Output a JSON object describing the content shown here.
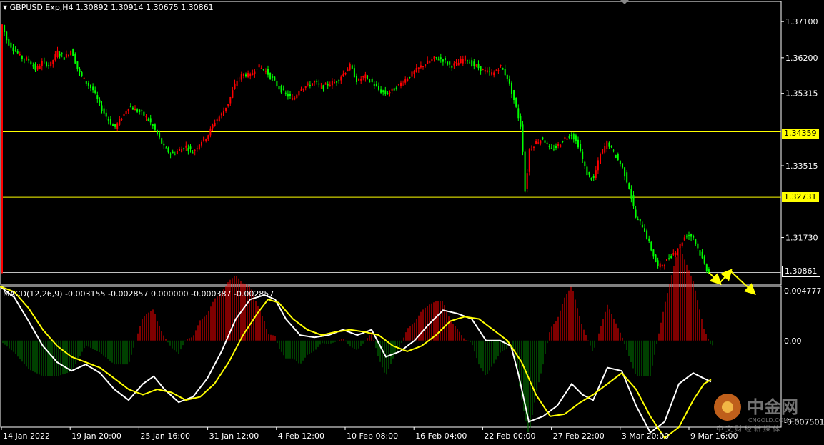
{
  "window": {
    "symbol_header": "GBPUSD.Exp,H4",
    "ohlc": [
      "1.30892",
      "1.30914",
      "1.30675",
      "1.30861"
    ]
  },
  "colors": {
    "background": "#000000",
    "bull": "#ff0000",
    "bear": "#00ff00",
    "level_line": "#ffff00",
    "macd_line": "#ffffff",
    "signal_line": "#ffff00",
    "hist_pos": "#ff0000",
    "hist_neg": "#008000",
    "arrow": "#ffff00"
  },
  "chart_data": [
    {
      "type": "candlestick",
      "title": "GBPUSD.Exp,H4",
      "y_ticks": [
        "1.37100",
        "1.36200",
        "1.35315",
        "1.34359",
        "1.33515",
        "1.32731",
        "1.31730",
        "1.30861"
      ],
      "ylim": [
        1.3055,
        1.376
      ],
      "x_ticks": [
        "14 Jan 2022",
        "19 Jan 20:00",
        "25 Jan 16:00",
        "31 Jan 12:00",
        "4 Feb 12:00",
        "10 Feb 08:00",
        "16 Feb 04:00",
        "22 Feb 00:00",
        "27 Feb 22:00",
        "3 Mar 20:00",
        "9 Mar 16:00"
      ],
      "horizontal_levels": [
        "1.34359",
        "1.32731"
      ],
      "current_price": "1.30861",
      "close_path": [
        [
          0,
          1.372
        ],
        [
          10,
          1.366
        ],
        [
          20,
          1.364
        ],
        [
          30,
          1.362
        ],
        [
          40,
          1.3615
        ],
        [
          50,
          1.359
        ],
        [
          60,
          1.361
        ],
        [
          70,
          1.36
        ],
        [
          80,
          1.3635
        ],
        [
          90,
          1.362
        ],
        [
          100,
          1.364
        ],
        [
          110,
          1.3585
        ],
        [
          120,
          1.356
        ],
        [
          130,
          1.354
        ],
        [
          140,
          1.35
        ],
        [
          150,
          1.347
        ],
        [
          160,
          1.3445
        ],
        [
          170,
          1.347
        ],
        [
          180,
          1.35
        ],
        [
          190,
          1.349
        ],
        [
          200,
          1.348
        ],
        [
          210,
          1.346
        ],
        [
          220,
          1.343
        ],
        [
          230,
          1.3395
        ],
        [
          240,
          1.338
        ],
        [
          250,
          1.339
        ],
        [
          260,
          1.34
        ],
        [
          270,
          1.3385
        ],
        [
          280,
          1.341
        ],
        [
          290,
          1.3425
        ],
        [
          300,
          1.346
        ],
        [
          310,
          1.348
        ],
        [
          320,
          1.351
        ],
        [
          330,
          1.356
        ],
        [
          340,
          1.358
        ],
        [
          350,
          1.3575
        ],
        [
          360,
          1.36
        ],
        [
          370,
          1.359
        ],
        [
          380,
          1.357
        ],
        [
          390,
          1.3545
        ],
        [
          400,
          1.353
        ],
        [
          410,
          1.3515
        ],
        [
          420,
          1.3545
        ],
        [
          430,
          1.355
        ],
        [
          440,
          1.356
        ],
        [
          450,
          1.3545
        ],
        [
          460,
          1.3555
        ],
        [
          470,
          1.356
        ],
        [
          480,
          1.358
        ],
        [
          490,
          1.36
        ],
        [
          500,
          1.356
        ],
        [
          510,
          1.3575
        ],
        [
          520,
          1.356
        ],
        [
          530,
          1.354
        ],
        [
          540,
          1.353
        ],
        [
          550,
          1.354
        ],
        [
          560,
          1.3555
        ],
        [
          570,
          1.357
        ],
        [
          580,
          1.3585
        ],
        [
          590,
          1.36
        ],
        [
          600,
          1.361
        ],
        [
          610,
          1.362
        ],
        [
          620,
          1.3615
        ],
        [
          630,
          1.36
        ],
        [
          640,
          1.3605
        ],
        [
          650,
          1.362
        ],
        [
          660,
          1.3605
        ],
        [
          670,
          1.3595
        ],
        [
          680,
          1.3585
        ],
        [
          690,
          1.358
        ],
        [
          700,
          1.36
        ],
        [
          710,
          1.357
        ],
        [
          720,
          1.351
        ],
        [
          730,
          1.344
        ],
        [
          735,
          1.3275
        ],
        [
          740,
          1.339
        ],
        [
          750,
          1.341
        ],
        [
          760,
          1.342
        ],
        [
          770,
          1.339
        ],
        [
          780,
          1.34
        ],
        [
          790,
          1.342
        ],
        [
          800,
          1.343
        ],
        [
          810,
          1.34
        ],
        [
          820,
          1.3335
        ],
        [
          830,
          1.3315
        ],
        [
          840,
          1.338
        ],
        [
          850,
          1.341
        ],
        [
          860,
          1.338
        ],
        [
          870,
          1.335
        ],
        [
          880,
          1.33
        ],
        [
          890,
          1.322
        ],
        [
          900,
          1.32
        ],
        [
          910,
          1.315
        ],
        [
          920,
          1.31
        ],
        [
          930,
          1.311
        ],
        [
          940,
          1.313
        ],
        [
          950,
          1.315
        ],
        [
          960,
          1.318
        ],
        [
          970,
          1.3175
        ],
        [
          980,
          1.313
        ],
        [
          990,
          1.309
        ],
        [
          995,
          1.3086
        ]
      ],
      "projection_arrows": [
        [
          992,
          1.3086
        ],
        [
          1007,
          1.306
        ],
        [
          1022,
          1.309
        ],
        [
          1055,
          1.3035
        ]
      ]
    },
    {
      "type": "line",
      "title": "MACD(12,26,9)",
      "header_values": [
        "-0.003155",
        "-0.002857",
        "0.000000",
        "-0.000387",
        "-0.002857"
      ],
      "y_ticks": [
        "0.004777",
        "0.00",
        "-0.007501"
      ],
      "ylim": [
        -0.008,
        0.005
      ],
      "series": [
        {
          "name": "MACD",
          "points": [
            [
              0,
              0.005
            ],
            [
              20,
              0.004
            ],
            [
              40,
              0.0018
            ],
            [
              60,
              -0.0005
            ],
            [
              80,
              -0.002
            ],
            [
              100,
              -0.0028
            ],
            [
              120,
              -0.0022
            ],
            [
              140,
              -0.003
            ],
            [
              160,
              -0.0045
            ],
            [
              180,
              -0.0055
            ],
            [
              200,
              -0.004
            ],
            [
              215,
              -0.0033
            ],
            [
              230,
              -0.0045
            ],
            [
              250,
              -0.0057
            ],
            [
              270,
              -0.0052
            ],
            [
              290,
              -0.0035
            ],
            [
              310,
              -0.001
            ],
            [
              330,
              0.002
            ],
            [
              350,
              0.0038
            ],
            [
              370,
              0.0042
            ],
            [
              385,
              0.0038
            ],
            [
              400,
              0.002
            ],
            [
              420,
              0.0005
            ],
            [
              440,
              0.0003
            ],
            [
              460,
              0.0005
            ],
            [
              480,
              0.001
            ],
            [
              500,
              0.0005
            ],
            [
              520,
              0.001
            ],
            [
              540,
              -0.0015
            ],
            [
              560,
              -0.001
            ],
            [
              580,
              0.0
            ],
            [
              600,
              0.0015
            ],
            [
              620,
              0.0028
            ],
            [
              640,
              0.0025
            ],
            [
              660,
              0.002
            ],
            [
              680,
              0.0
            ],
            [
              700,
              0.0
            ],
            [
              715,
              -0.0005
            ],
            [
              725,
              -0.003
            ],
            [
              740,
              -0.0075
            ],
            [
              760,
              -0.007
            ],
            [
              780,
              -0.006
            ],
            [
              800,
              -0.004
            ],
            [
              815,
              -0.005
            ],
            [
              830,
              -0.0055
            ],
            [
              850,
              -0.0025
            ],
            [
              870,
              -0.0028
            ],
            [
              890,
              -0.006
            ],
            [
              910,
              -0.0085
            ],
            [
              930,
              -0.0075
            ],
            [
              950,
              -0.004
            ],
            [
              970,
              -0.003
            ],
            [
              985,
              -0.0035
            ],
            [
              995,
              -0.0038
            ]
          ]
        },
        {
          "name": "Signal",
          "points": [
            [
              0,
              0.005
            ],
            [
              20,
              0.0045
            ],
            [
              40,
              0.003
            ],
            [
              60,
              0.001
            ],
            [
              80,
              -0.0005
            ],
            [
              100,
              -0.0015
            ],
            [
              120,
              -0.002
            ],
            [
              140,
              -0.0025
            ],
            [
              160,
              -0.0035
            ],
            [
              180,
              -0.0045
            ],
            [
              200,
              -0.005
            ],
            [
              220,
              -0.0045
            ],
            [
              240,
              -0.0048
            ],
            [
              260,
              -0.0055
            ],
            [
              280,
              -0.0052
            ],
            [
              300,
              -0.004
            ],
            [
              320,
              -0.002
            ],
            [
              340,
              0.0005
            ],
            [
              360,
              0.0025
            ],
            [
              375,
              0.0038
            ],
            [
              390,
              0.0035
            ],
            [
              410,
              0.002
            ],
            [
              430,
              0.001
            ],
            [
              450,
              0.0005
            ],
            [
              470,
              0.0008
            ],
            [
              490,
              0.001
            ],
            [
              510,
              0.0008
            ],
            [
              530,
              0.0005
            ],
            [
              550,
              -0.0005
            ],
            [
              570,
              -0.001
            ],
            [
              590,
              -0.0005
            ],
            [
              610,
              0.0005
            ],
            [
              630,
              0.0018
            ],
            [
              650,
              0.0022
            ],
            [
              670,
              0.002
            ],
            [
              690,
              0.001
            ],
            [
              710,
              0.0
            ],
            [
              730,
              -0.002
            ],
            [
              750,
              -0.005
            ],
            [
              770,
              -0.007
            ],
            [
              790,
              -0.0068
            ],
            [
              810,
              -0.0058
            ],
            [
              830,
              -0.005
            ],
            [
              850,
              -0.004
            ],
            [
              870,
              -0.003
            ],
            [
              890,
              -0.0045
            ],
            [
              910,
              -0.007
            ],
            [
              930,
              -0.009
            ],
            [
              950,
              -0.008
            ],
            [
              970,
              -0.0055
            ],
            [
              985,
              -0.004
            ],
            [
              995,
              -0.0036
            ]
          ]
        }
      ]
    }
  ],
  "watermark": {
    "main": "中金网",
    "domain": "CNGOLD.COM.CN",
    "subtitle": "中 文 财 经 新 媒 体"
  }
}
